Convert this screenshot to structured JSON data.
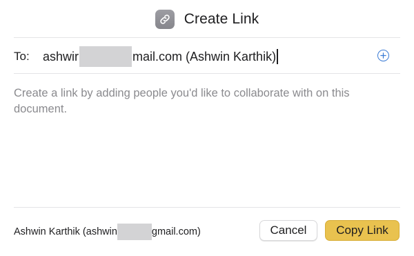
{
  "dialog": {
    "title": "Create Link",
    "icon": "link-icon",
    "to_label": "To:",
    "recipient": {
      "prefix": "ashwir",
      "suffix": "mail.com (Ashwin Karthik)"
    },
    "add_icon": "plus-circle-icon",
    "hint": "Create a link by adding people you'd like to collaborate with on this document.",
    "footer_user": {
      "prefix": "Ashwin Karthik (ashwin",
      "suffix": "gmail.com)"
    },
    "buttons": {
      "cancel": "Cancel",
      "copy": "Copy Link"
    },
    "colors": {
      "accent": "#e9c24f",
      "add_icon": "#3a7bd5",
      "hint_text": "#8a8a8e"
    }
  }
}
